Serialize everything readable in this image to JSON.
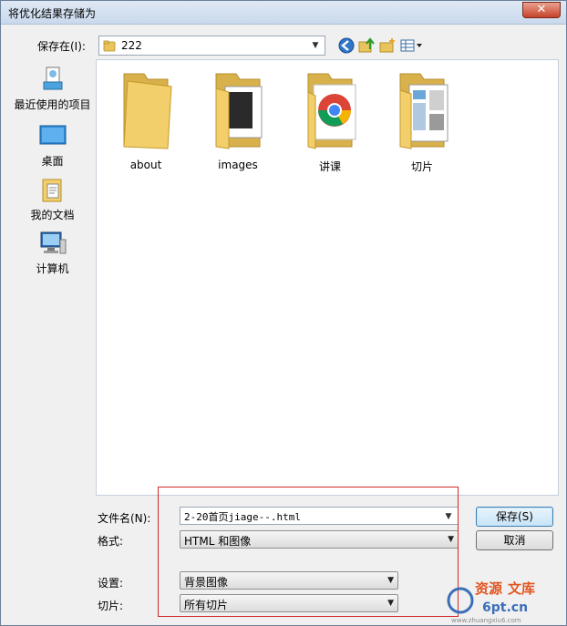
{
  "window": {
    "title": "将优化结果存储为",
    "close_glyph": "✕"
  },
  "save_in": {
    "label": "保存在(I):",
    "value": "222"
  },
  "places": [
    {
      "label": "最近使用的项目",
      "icon": "recent-items-icon"
    },
    {
      "label": "桌面",
      "icon": "desktop-icon"
    },
    {
      "label": "我的文档",
      "icon": "my-documents-icon"
    },
    {
      "label": "计算机",
      "icon": "computer-icon"
    }
  ],
  "files": [
    {
      "label": "about",
      "icon": "folder-icon"
    },
    {
      "label": "images",
      "icon": "folder-images-icon"
    },
    {
      "label": "讲课",
      "icon": "chrome-folder-icon"
    },
    {
      "label": "切片",
      "icon": "folder-slices-icon"
    }
  ],
  "form": {
    "filename_label": "文件名(N):",
    "filename_value": "2-20首页jiage--.html",
    "format_label": "格式:",
    "format_value": "HTML 和图像",
    "settings_label": "设置:",
    "settings_value": "背景图像",
    "slices_label": "切片:",
    "slices_value": "所有切片"
  },
  "buttons": {
    "save": "保存(S)",
    "cancel": "取消"
  },
  "watermark": {
    "text": "资源 文库",
    "url": "www.zhuangxiu6.com",
    "mark": "6pt.cn"
  },
  "colors": {
    "highlight_box": "#d12a2a",
    "folder": "#f2cf6a"
  }
}
